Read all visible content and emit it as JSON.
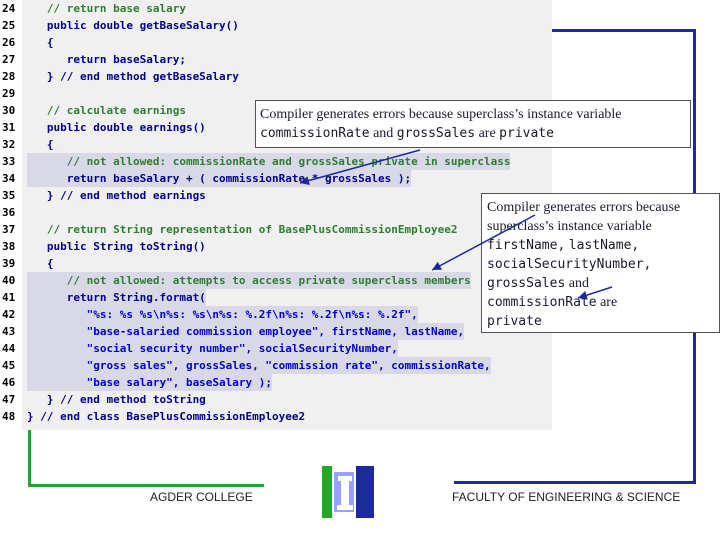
{
  "code": {
    "lines": [
      {
        "n": "24",
        "t": "   // return base salary"
      },
      {
        "n": "25",
        "t": "   public double getBaseSalary()"
      },
      {
        "n": "26",
        "t": "   {"
      },
      {
        "n": "27",
        "t": "      return baseSalary;"
      },
      {
        "n": "28",
        "t": "   } // end method getBaseSalary"
      },
      {
        "n": "29",
        "t": ""
      },
      {
        "n": "30",
        "t": "   // calculate earnings"
      },
      {
        "n": "31",
        "t": "   public double earnings()"
      },
      {
        "n": "32",
        "t": "   {"
      },
      {
        "n": "33",
        "t": "      // not allowed: commissionRate and grossSales private in superclass"
      },
      {
        "n": "34",
        "t": "      return baseSalary + ( commissionRate * grossSales );"
      },
      {
        "n": "35",
        "t": "   } // end method earnings"
      },
      {
        "n": "36",
        "t": ""
      },
      {
        "n": "37",
        "t": "   // return String representation of BasePlusCommissionEmployee2"
      },
      {
        "n": "38",
        "t": "   public String toString()"
      },
      {
        "n": "39",
        "t": "   {"
      },
      {
        "n": "40",
        "t": "      // not allowed: attempts to access private superclass members"
      },
      {
        "n": "41",
        "t": "      return String.format("
      },
      {
        "n": "42",
        "t": "         \"%s: %s %s\\n%s: %s\\n%s: %.2f\\n%s: %.2f\\n%s: %.2f\","
      },
      {
        "n": "43",
        "t": "         \"base-salaried commission employee\", firstName, lastName,"
      },
      {
        "n": "44",
        "t": "         \"social security number\", socialSecurityNumber,"
      },
      {
        "n": "45",
        "t": "         \"gross sales\", grossSales, \"commission rate\", commissionRate,"
      },
      {
        "n": "46",
        "t": "         \"base salary\", baseSalary );"
      },
      {
        "n": "47",
        "t": "   } // end method toString"
      },
      {
        "n": "48",
        "t": "} // end class BasePlusCommissionEmployee2"
      }
    ]
  },
  "callout1": {
    "text1": "Compiler generates errors because superclass’s instance variable",
    "v1": "commissionRate",
    "and": "and",
    "v2": "grossSales",
    "are": "are",
    "v3": "private"
  },
  "callout2": {
    "line1": "Compiler generates errors because",
    "line2": "superclass’s instance variable",
    "v1": "firstName,",
    "v2": "lastName,",
    "v3": "socialSecurityNumber,",
    "v4": "grossSales",
    "and": "and",
    "v5": "commissionRate",
    "are": "are",
    "v6": "private"
  },
  "footer": {
    "left": "AGDER COLLEGE",
    "right": "FACULTY OF ENGINEERING & SCIENCE"
  },
  "colors": {
    "frame_blue": "#1c2a9c",
    "frame_green": "#2e9e2e",
    "error_red": "#cc0000",
    "comment_green": "#2e7d32"
  }
}
